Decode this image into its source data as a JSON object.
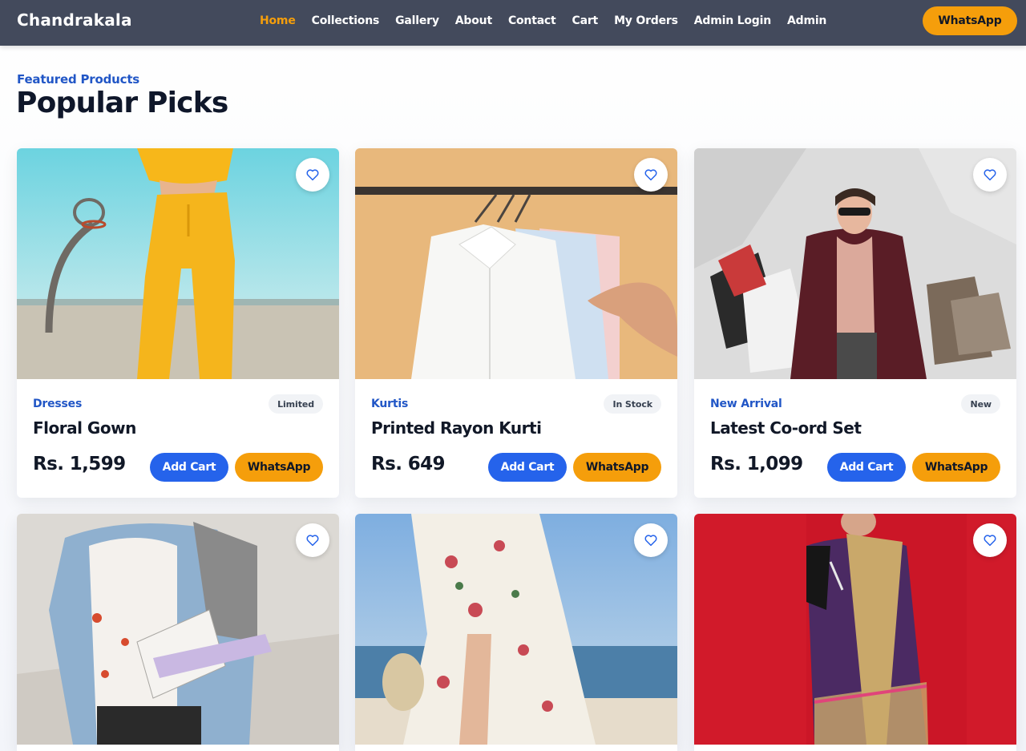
{
  "nav": {
    "brand": "Chandrakala",
    "links": [
      "Home",
      "Collections",
      "Gallery",
      "About",
      "Contact",
      "Cart",
      "My Orders",
      "Admin Login",
      "Admin"
    ],
    "active": "Home",
    "whatsapp_label": "WhatsApp"
  },
  "section": {
    "kicker": "Featured Products",
    "title": "Popular Picks"
  },
  "products": [
    {
      "category": "Dresses",
      "badge": "Limited",
      "name": "Floral Gown",
      "price": "Rs. 1,599",
      "cart_label": "Add Cart",
      "whatsapp_label": "WhatsApp",
      "image": "yellow-tracksuit-photo"
    },
    {
      "category": "Kurtis",
      "badge": "In Stock",
      "name": "Printed Rayon Kurti",
      "price": "Rs. 649",
      "cart_label": "Add Cart",
      "whatsapp_label": "WhatsApp",
      "image": "shirts-on-rack-photo"
    },
    {
      "category": "New Arrival",
      "badge": "New",
      "name": "Latest Co-ord Set",
      "price": "Rs. 1,099",
      "cart_label": "Add Cart",
      "whatsapp_label": "WhatsApp",
      "image": "shopping-woman-photo"
    },
    {
      "image": "denim-jacket-student-photo"
    },
    {
      "image": "floral-wrap-dress-photo"
    },
    {
      "image": "purple-saree-photo"
    }
  ],
  "colors": {
    "navbar": "#434a5c",
    "accent_orange": "#f59e0b",
    "accent_blue": "#2563eb",
    "kicker_blue": "#2156c6"
  },
  "icons": {
    "wishlist": "heart-outline-icon"
  }
}
